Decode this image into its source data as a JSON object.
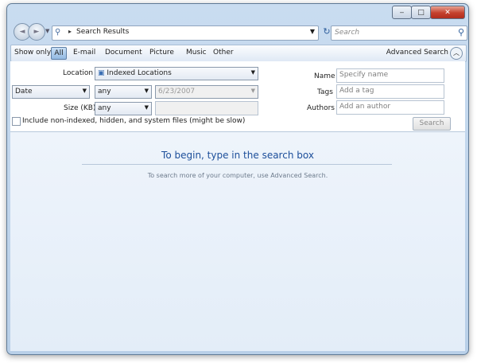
{
  "titlebar": {
    "min_glyph": "‒",
    "max_glyph": "□",
    "close_glyph": "✕"
  },
  "nav": {
    "back_glyph": "◄",
    "fwd_glyph": "►"
  },
  "address": {
    "path_sep": "▸",
    "text": "Search Results"
  },
  "search": {
    "placeholder": "Search"
  },
  "filters": {
    "show_only": "Show only:",
    "all": "All",
    "items": [
      "E-mail",
      "Document",
      "Picture",
      "Music",
      "Other"
    ],
    "advanced": "Advanced Search"
  },
  "advanced": {
    "location_label": "Location",
    "location_value": "Indexed Locations",
    "date_field": "Date",
    "date_op": "any",
    "date_value": "6/23/2007",
    "size_label": "Size (KB)",
    "size_op": "any",
    "name_label": "Name",
    "name_placeholder": "Specify name",
    "tags_label": "Tags",
    "tags_placeholder": "Add a tag",
    "authors_label": "Authors",
    "authors_placeholder": "Add an author",
    "include_label": "Include non-indexed, hidden, and system files (might be slow)",
    "search_button": "Search"
  },
  "content": {
    "headline": "To begin, type in the search box",
    "subtext": "To search more of your computer, use Advanced Search."
  }
}
